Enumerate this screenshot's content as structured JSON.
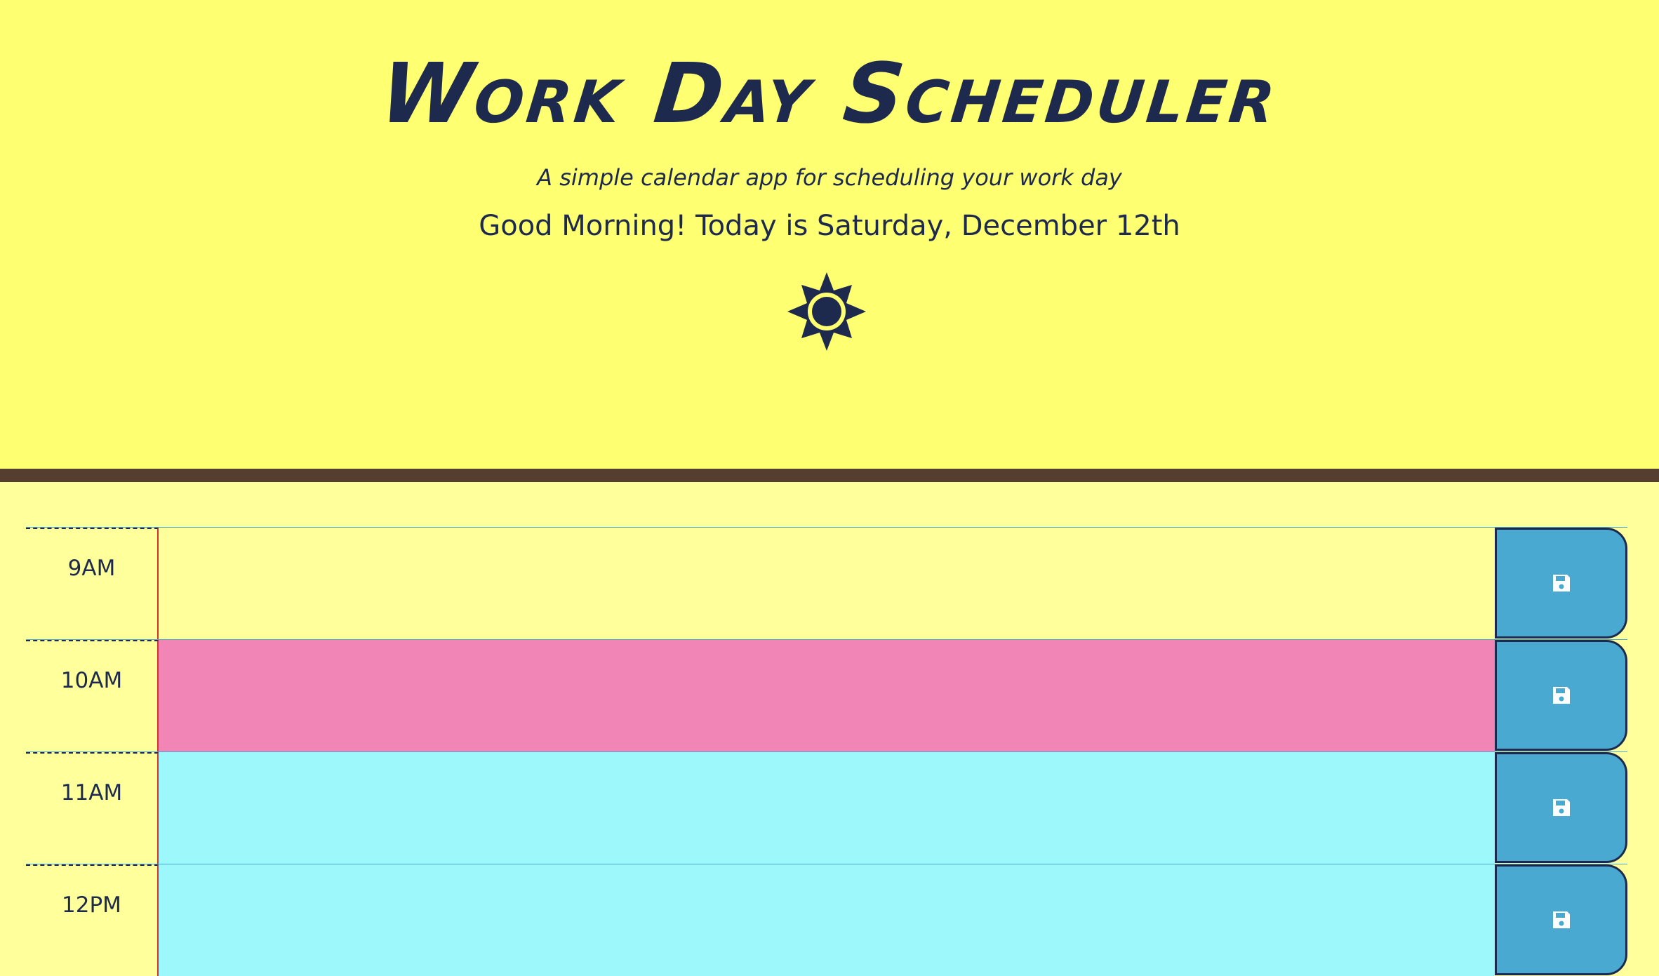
{
  "header": {
    "title": "Work Day Scheduler",
    "subtitle": "A simple calendar app for scheduling your work day",
    "greeting": "Good Morning! Today is Saturday, December 12th",
    "icon": "sun-icon"
  },
  "colors": {
    "header_bg": "#ffff72",
    "page_bg": "#ffff9c",
    "divider": "#553d2f",
    "text": "#1d2a4d",
    "past": "#ffff9c",
    "present": "#f085b6",
    "future": "#9cf8fb",
    "save_button": "#4aa9d1"
  },
  "schedule": {
    "blocks": [
      {
        "hour": "9AM",
        "state": "past",
        "text": "",
        "save_icon": "floppy-disk-icon"
      },
      {
        "hour": "10AM",
        "state": "present",
        "text": "",
        "save_icon": "floppy-disk-icon"
      },
      {
        "hour": "11AM",
        "state": "future",
        "text": "",
        "save_icon": "floppy-disk-icon"
      },
      {
        "hour": "12PM",
        "state": "future",
        "text": "",
        "save_icon": "floppy-disk-icon"
      }
    ]
  }
}
